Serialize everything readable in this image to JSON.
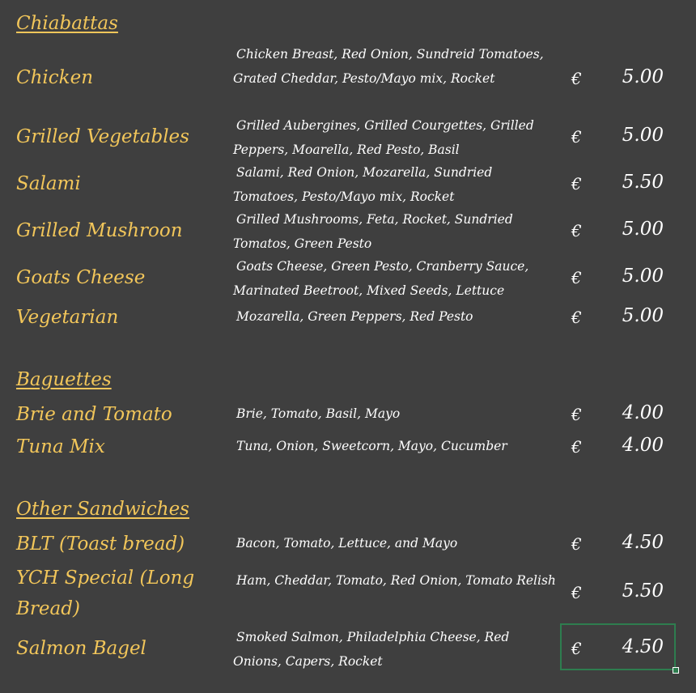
{
  "sections": {
    "chiabattas": "Chiabattas",
    "baguettes": "Baguettes",
    "other": "Other Sandwiches"
  },
  "currency": "€",
  "items": [
    {
      "name": "Chicken",
      "desc": "Chicken Breast, Red Onion, Sundreid Tomatoes, Grated Cheddar, Pesto/Mayo mix, Rocket",
      "price": "5.00"
    },
    {
      "name": "Grilled Vegetables",
      "desc": "Grilled Aubergines, Grilled Courgettes, Grilled Peppers, Moarella, Red Pesto, Basil",
      "price": "5.00"
    },
    {
      "name": "Salami",
      "desc": "Salami, Red Onion, Mozarella, Sundried Tomatoes, Pesto/Mayo mix, Rocket",
      "price": "5.50"
    },
    {
      "name": "Grilled Mushroon",
      "desc": "Grilled Mushrooms, Feta, Rocket, Sundried Tomatos, Green Pesto",
      "price": "5.00"
    },
    {
      "name": "Goats Cheese",
      "desc": "Goats Cheese, Green Pesto, Cranberry Sauce, Marinated Beetroot, Mixed Seeds, Lettuce",
      "price": "5.00"
    },
    {
      "name": "Vegetarian",
      "desc": "Mozarella, Green Peppers, Red Pesto",
      "price": "5.00"
    },
    {
      "name": "Brie and Tomato",
      "desc": "Brie, Tomato, Basil, Mayo",
      "price": "4.00"
    },
    {
      "name": "Tuna Mix",
      "desc": "Tuna, Onion, Sweetcorn, Mayo, Cucumber",
      "price": "4.00"
    },
    {
      "name": "BLT (Toast bread)",
      "desc": "Bacon, Tomato, Lettuce, and Mayo",
      "price": "4.50"
    },
    {
      "name": "YCH Special (Long Bread)",
      "desc": "Ham, Cheddar, Tomato, Red Onion, Tomato Relish",
      "price": "5.50"
    },
    {
      "name": "Salmon Bagel",
      "desc": "Smoked Salmon, Philadelphia Cheese, Red Onions, Capers, Rocket",
      "price": "4.50"
    }
  ]
}
